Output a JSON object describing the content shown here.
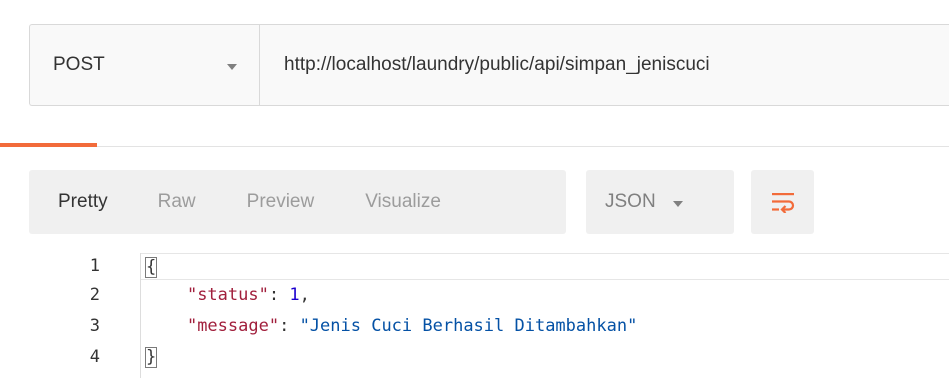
{
  "request": {
    "method": "POST",
    "url": "http://localhost/laundry/public/api/simpan_jeniscuci"
  },
  "response_toolbar": {
    "tabs": [
      {
        "label": "Pretty",
        "selected": true
      },
      {
        "label": "Raw",
        "selected": false
      },
      {
        "label": "Preview",
        "selected": false
      },
      {
        "label": "Visualize",
        "selected": false
      }
    ],
    "format": "JSON",
    "wrap_icon": "wrap-lines-icon"
  },
  "editor": {
    "line_numbers": [
      "1",
      "2",
      "3",
      "4"
    ],
    "lines": {
      "open_brace": "{",
      "status_key": "\"status\"",
      "status_value": "1",
      "message_key": "\"message\"",
      "message_value": "\"Jenis Cuci Berhasil Ditambahkan\"",
      "close_brace": "}"
    }
  },
  "colors": {
    "accent": "#f26b3a",
    "json_key": "#a11f3c",
    "json_number": "#1c00cf",
    "json_string": "#0451a5"
  }
}
